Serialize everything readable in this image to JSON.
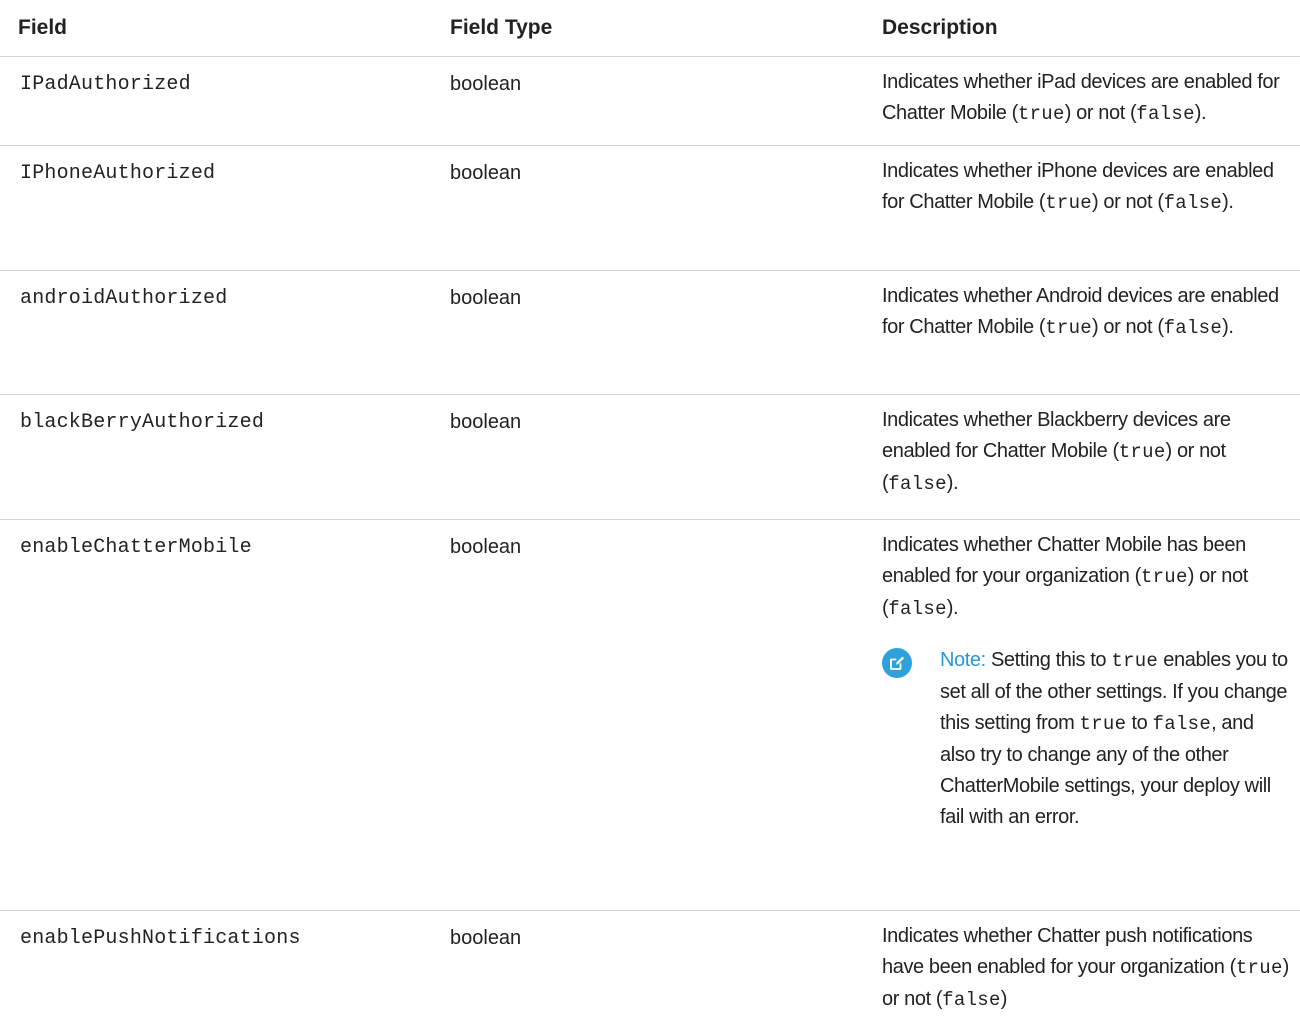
{
  "headers": {
    "field": "Field",
    "type": "Field Type",
    "description": "Description"
  },
  "rows": [
    {
      "field": "IPadAuthorized",
      "type": "boolean",
      "desc": {
        "p1": "Indicates whether iPad devices are enabled for Chatter Mobile (",
        "c1": "true",
        "p2": ") or not (",
        "c2": "false",
        "p3": ")."
      }
    },
    {
      "field": "IPhoneAuthorized",
      "type": "boolean",
      "desc": {
        "p1": "Indicates whether iPhone devices are enabled for Chatter Mobile (",
        "c1": "true",
        "p2": ") or not (",
        "c2": "false",
        "p3": ")."
      }
    },
    {
      "field": "androidAuthorized",
      "type": "boolean",
      "desc": {
        "p1": "Indicates whether Android devices are enabled for Chatter Mobile (",
        "c1": "true",
        "p2": ") or not (",
        "c2": "false",
        "p3": ")."
      }
    },
    {
      "field": "blackBerryAuthorized",
      "type": "boolean",
      "desc": {
        "p1": "Indicates whether Blackberry devices are enabled for Chatter Mobile (",
        "c1": "true",
        "p2": ") or not (",
        "c2": "false",
        "p3": ")."
      }
    },
    {
      "field": "enableChatterMobile",
      "type": "boolean",
      "desc": {
        "p1": "Indicates whether Chatter Mobile has been enabled for your organization (",
        "c1": "true",
        "p2": ") or not (",
        "c2": "false",
        "p3": ")."
      },
      "note": {
        "label": "Note:",
        "t1": " Setting this to ",
        "c1": "true",
        "t2": " enables you to set all of the other settings. If you change this setting from ",
        "c2": "true",
        "t3": " to ",
        "c3": "false",
        "t4": ", and also try to change any of the other ChatterMobile settings, your deploy will fail with an error."
      }
    },
    {
      "field": "enablePushNotifications",
      "type": "boolean",
      "desc": {
        "p1": "Indicates whether Chatter push notifications have been enabled for your organization (",
        "c1": "true",
        "p2": ") or not (",
        "c2": "false",
        "p3": ")"
      }
    }
  ],
  "icons": {
    "note": "edit-note-icon"
  },
  "colors": {
    "note_accent": "#2a98d6",
    "note_icon_bg": "#2ea1dd"
  }
}
